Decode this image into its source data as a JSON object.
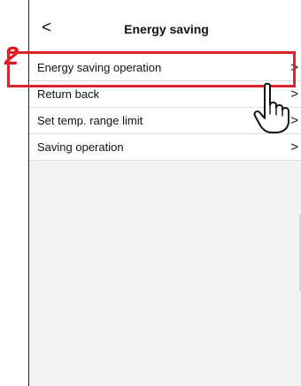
{
  "step": {
    "number": "2"
  },
  "header": {
    "title": "Energy saving",
    "back_icon": "chevron-left-icon"
  },
  "menu": {
    "items": [
      {
        "label": "Energy saving operation",
        "icon": "chevron-right-icon",
        "highlighted": true
      },
      {
        "label": "Return back",
        "icon": "chevron-right-icon"
      },
      {
        "label": "Set temp. range limit",
        "icon": "chevron-right-icon"
      },
      {
        "label": "Saving operation",
        "icon": "chevron-right-icon"
      }
    ]
  },
  "colors": {
    "highlight": "#d9262c",
    "step_number": "#e3141b",
    "background": "#f2f2f2"
  },
  "pointer": {
    "icon": "hand-pointer-icon"
  }
}
